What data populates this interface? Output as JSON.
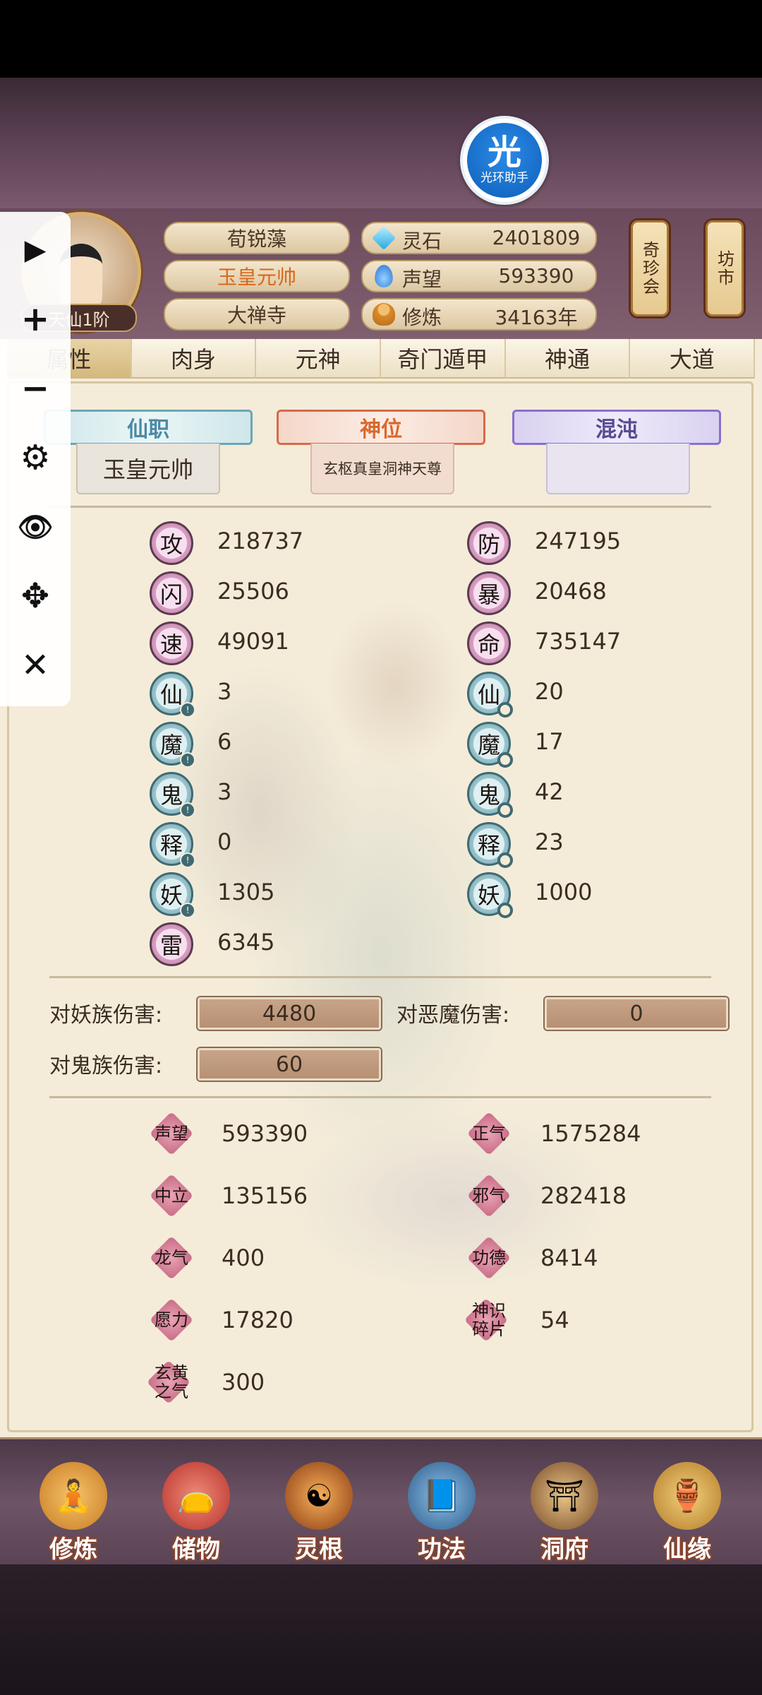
{
  "halo": {
    "big": "光",
    "small": "光环助手"
  },
  "player": {
    "rank": "天仙1阶"
  },
  "info_pills": {
    "name": "荀锐藻",
    "title": "玉皇元帅",
    "sect": "大禅寺"
  },
  "resources": [
    {
      "icon": "spirit-stone-icon",
      "label": "灵石",
      "value": "2401809"
    },
    {
      "icon": "reputation-drop-icon",
      "label": "声望",
      "value": "593390"
    },
    {
      "icon": "meditation-icon",
      "label": "修炼",
      "value": "34163年"
    }
  ],
  "side_buttons": {
    "treasure": "奇珍会",
    "market": "坊市"
  },
  "tabs": [
    "属性",
    "肉身",
    "元神",
    "奇门遁甲",
    "神通",
    "大道"
  ],
  "banners": {
    "xianzhi": "仙职",
    "xianzhi_value": "玉皇元帅",
    "shenwei": "神位",
    "shenwei_value": "玄枢真皇洞神天尊",
    "hundun": "混沌"
  },
  "combat_left": [
    {
      "glyph": "攻",
      "value": "218737"
    },
    {
      "glyph": "闪",
      "value": "25506"
    },
    {
      "glyph": "速",
      "value": "49091"
    }
  ],
  "combat_right": [
    {
      "glyph": "防",
      "value": "247195"
    },
    {
      "glyph": "暴",
      "value": "20468"
    },
    {
      "glyph": "命",
      "value": "735147"
    }
  ],
  "race_left": [
    {
      "glyph": "仙",
      "value": "3"
    },
    {
      "glyph": "魔",
      "value": "6"
    },
    {
      "glyph": "鬼",
      "value": "3"
    },
    {
      "glyph": "释",
      "value": "0"
    },
    {
      "glyph": "妖",
      "value": "1305"
    },
    {
      "glyph": "雷",
      "value": "6345"
    }
  ],
  "race_right": [
    {
      "glyph": "仙",
      "value": "20"
    },
    {
      "glyph": "魔",
      "value": "17"
    },
    {
      "glyph": "鬼",
      "value": "42"
    },
    {
      "glyph": "释",
      "value": "23"
    },
    {
      "glyph": "妖",
      "value": "1000"
    }
  ],
  "damage": {
    "yao_label": "对妖族伤害:",
    "yao_value": "4480",
    "demon_label": "对恶魔伤害:",
    "demon_value": "0",
    "ghost_label": "对鬼族伤害:",
    "ghost_value": "60"
  },
  "reputation_left": [
    {
      "label": "声望",
      "value": "593390"
    },
    {
      "label": "中立",
      "value": "135156"
    },
    {
      "label": "龙气",
      "value": "400"
    },
    {
      "label": "愿力",
      "value": "17820"
    },
    {
      "label": "玄黄之气",
      "value": "300"
    }
  ],
  "reputation_right": [
    {
      "label": "正气",
      "value": "1575284"
    },
    {
      "label": "邪气",
      "value": "282418"
    },
    {
      "label": "功德",
      "value": "8414"
    },
    {
      "label": "神识碎片",
      "value": "54"
    }
  ],
  "bottom_nav": [
    {
      "label": "修炼",
      "icon": "cultivate-icon"
    },
    {
      "label": "储物",
      "icon": "storage-bag-icon"
    },
    {
      "label": "灵根",
      "icon": "spirit-root-icon"
    },
    {
      "label": "功法",
      "icon": "scripture-book-icon"
    },
    {
      "label": "洞府",
      "icon": "cave-mansion-icon"
    },
    {
      "label": "仙缘",
      "icon": "gourd-icon"
    }
  ],
  "toolbar": {
    "play": "▶",
    "plus": "+",
    "minus": "−",
    "settings": "⚙",
    "eye": "👁",
    "move": "✥",
    "close": "✕"
  }
}
